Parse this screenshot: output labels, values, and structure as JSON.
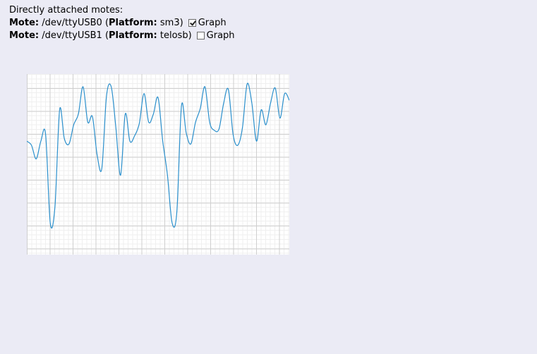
{
  "heading": "Directly attached motes:",
  "motes": [
    {
      "mote_label": "Mote:",
      "device": "/dev/ttyUSB0",
      "platform_label": "Platform:",
      "platform": "sm3",
      "graph_label": "Graph",
      "graph_checked": true
    },
    {
      "mote_label": "Mote:",
      "device": "/dev/ttyUSB1",
      "platform_label": "Platform:",
      "platform": "telosb",
      "graph_label": "Graph",
      "graph_checked": false
    }
  ],
  "colors": {
    "page_background": "#ebebf5",
    "line": "#2a8fcc",
    "grid_major": "#cfcfcf",
    "grid_minor": "#efefef"
  },
  "chart_data": {
    "type": "line",
    "x": [
      0,
      1,
      2,
      3,
      4,
      5,
      6,
      7,
      8,
      9,
      10,
      11,
      12,
      13,
      14,
      15,
      16,
      17,
      18,
      19,
      20,
      21,
      22,
      23,
      24,
      25,
      26,
      27,
      28,
      29,
      30,
      31,
      32,
      33,
      34,
      35,
      36,
      37,
      38,
      39,
      40,
      41,
      42,
      43,
      44,
      45,
      46,
      47,
      48,
      49,
      50,
      51,
      52,
      53,
      54,
      55,
      56
    ],
    "values": [
      60,
      57,
      47,
      60,
      65,
      0,
      12,
      83,
      62,
      58,
      72,
      80,
      100,
      74,
      78,
      50,
      40,
      93,
      100,
      70,
      35,
      80,
      60,
      64,
      73,
      95,
      74,
      80,
      92,
      60,
      35,
      0,
      8,
      86,
      66,
      58,
      74,
      84,
      100,
      74,
      68,
      69,
      88,
      98,
      65,
      57,
      70,
      102,
      88,
      60,
      83,
      72,
      88,
      99,
      77,
      95,
      90
    ],
    "grid": true
  }
}
